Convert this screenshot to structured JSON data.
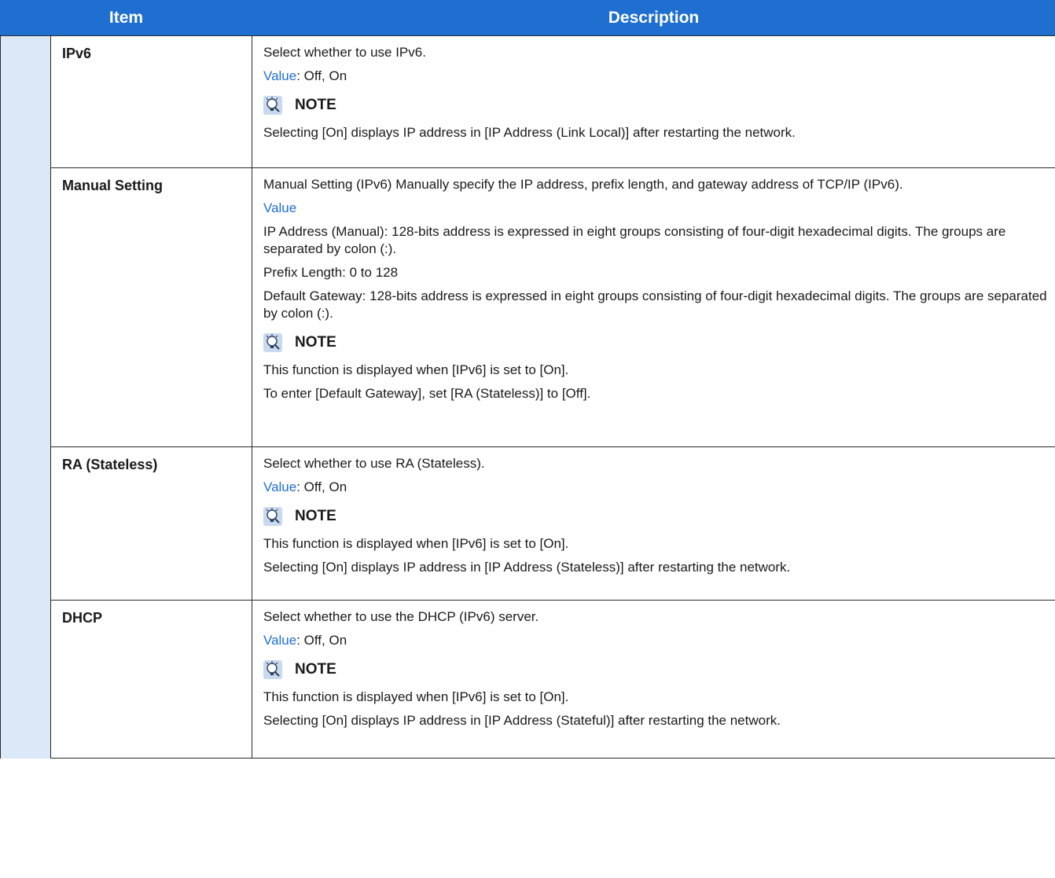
{
  "header": {
    "item": "Item",
    "description": "Description"
  },
  "note_label": "NOTE",
  "rows": {
    "0": {
      "item": "IPv6",
      "desc": "Select whether to use IPv6.",
      "value_label": "Value",
      "value_text": ": Off, On",
      "note_lines": [
        "Selecting [On] displays IP address in [IP Address (Link Local)] after restarting the network."
      ]
    },
    "1": {
      "item": "Manual Setting",
      "desc": "Manual Setting (IPv6) Manually specify the IP address, prefix length, and gateway address of TCP/IP (IPv6).",
      "value_label": "Value",
      "lines": [
        "IP Address (Manual): 128-bits address is expressed in eight groups consisting of four-digit hexadecimal digits. The groups are separated by colon (:).",
        "Prefix Length: 0 to 128",
        "Default Gateway: 128-bits address is expressed in eight groups consisting of four-digit hexadecimal digits. The groups are separated by colon (:)."
      ],
      "note_lines": [
        "This function is displayed when [IPv6] is set to [On].",
        "To enter [Default Gateway], set [RA (Stateless)] to [Off]."
      ]
    },
    "2": {
      "item": "RA (Stateless)",
      "desc": "Select whether to use RA (Stateless).",
      "value_label": "Value",
      "value_text": ": Off, On",
      "note_lines": [
        "This function is displayed when [IPv6] is set to [On].",
        "Selecting [On] displays IP address in [IP Address (Stateless)] after restarting the network."
      ]
    },
    "3": {
      "item": "DHCP",
      "desc": "Select whether to use the DHCP (IPv6) server.",
      "value_label": "Value",
      "value_text": ": Off, On",
      "note_lines": [
        "This function is displayed when [IPv6] is set to [On].",
        "Selecting [On] displays IP address in [IP Address (Stateful)] after restarting the network."
      ]
    }
  },
  "colors": {
    "header_bg": "#1f6fd0",
    "indent_bg": "#dbe8f7",
    "keyword": "#1f6fd0"
  },
  "icons": {
    "note": "lightbulb-note-icon"
  }
}
